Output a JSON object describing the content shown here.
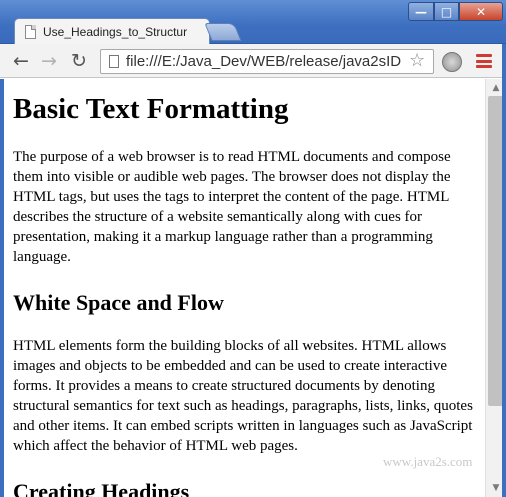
{
  "window": {
    "tab_title": "Use_Headings_to_Structur",
    "min_glyph": "—",
    "max_glyph": "□",
    "close_glyph": "✕"
  },
  "toolbar": {
    "back_glyph": "←",
    "forward_glyph": "→",
    "reload_glyph": "↻",
    "url": "file:///E:/Java_Dev/WEB/release/java2sID",
    "star_glyph": "☆",
    "icons": [
      "back-arrow-icon",
      "forward-arrow-icon",
      "reload-icon",
      "page-icon",
      "bookmark-star-icon",
      "extension-icon",
      "menu-icon"
    ]
  },
  "page": {
    "h1": "Basic Text Formatting",
    "p1": "The purpose of a web browser is to read HTML documents and compose them into visible or audible web pages. The browser does not display the HTML tags, but uses the tags to interpret the content of the page. HTML describes the structure of a website semantically along with cues for presentation, making it a markup language rather than a programming language.",
    "h2_1": "White Space and Flow",
    "p2": "HTML elements form the building blocks of all websites. HTML allows images and objects to be embedded and can be used to create interactive forms. It provides a means to create structured documents by denoting structural semantics for text such as headings, paragraphs, lists, links, quotes and other items. It can embed scripts written in languages such as JavaScript which affect the behavior of HTML web pages.",
    "h2_2": "Creating Headings"
  },
  "watermark": "www.java2s.com",
  "scrollbar": {
    "up_glyph": "▲",
    "down_glyph": "▼"
  },
  "colors": {
    "frame_blue": "#3d6fc0",
    "menu_red": "#cf3b33",
    "close_red": "#c7442b"
  }
}
